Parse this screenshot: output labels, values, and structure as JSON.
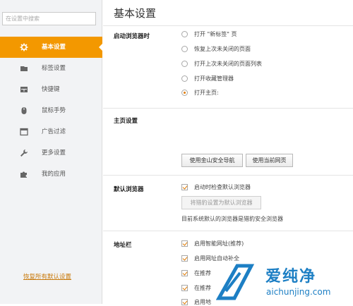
{
  "sidebar": {
    "search_placeholder": "在设置中搜索",
    "items": [
      {
        "label": "基本设置",
        "icon": "gear-icon",
        "active": true
      },
      {
        "label": "标签设置",
        "icon": "tab-icon",
        "active": false
      },
      {
        "label": "快捷键",
        "icon": "keyboard-icon",
        "active": false
      },
      {
        "label": "鼠标手势",
        "icon": "mouse-icon",
        "active": false
      },
      {
        "label": "广告过滤",
        "icon": "window-icon",
        "active": false
      },
      {
        "label": "更多设置",
        "icon": "wrench-icon",
        "active": false
      },
      {
        "label": "我的应用",
        "icon": "puzzle-icon",
        "active": false
      }
    ],
    "reset_link": "恢复所有默认设置"
  },
  "main": {
    "title": "基本设置",
    "startup": {
      "label": "启动浏览器时",
      "options": [
        {
          "label": "打开 \"新标签\" 页",
          "checked": false
        },
        {
          "label": "恢复上次未关闭的页面",
          "checked": false
        },
        {
          "label": "打开上次未关闭的页面列表",
          "checked": false
        },
        {
          "label": "打开收藏管理器",
          "checked": false
        },
        {
          "label": "打开主页:",
          "checked": true
        }
      ]
    },
    "homepage": {
      "label": "主页设置",
      "btn_nav": "使用金山安全导航",
      "btn_current": "使用当前网页"
    },
    "default_browser": {
      "label": "默认浏览器",
      "check_label": "启动时检查默认浏览器",
      "checked": true,
      "btn_set_default": "将猎豹设置为默认浏览器",
      "status": "目前系统默认的浏览器是猎豹安全浏览器"
    },
    "address_bar": {
      "label": "地址栏",
      "options": [
        {
          "label": "启用智能网址(推荐)",
          "checked": true
        },
        {
          "label": "启用网址自动补全",
          "checked": true
        },
        {
          "label": "在推荐",
          "checked": true
        },
        {
          "label": "在推荐",
          "checked": true
        },
        {
          "label": "启用地",
          "checked": true
        }
      ]
    }
  },
  "watermark": {
    "text": "爱纯净",
    "url": "aichunjing.com"
  },
  "colors": {
    "accent": "#f39800",
    "sidebar_bg": "#f2f3f5",
    "watermark": "#1d7fc4"
  }
}
